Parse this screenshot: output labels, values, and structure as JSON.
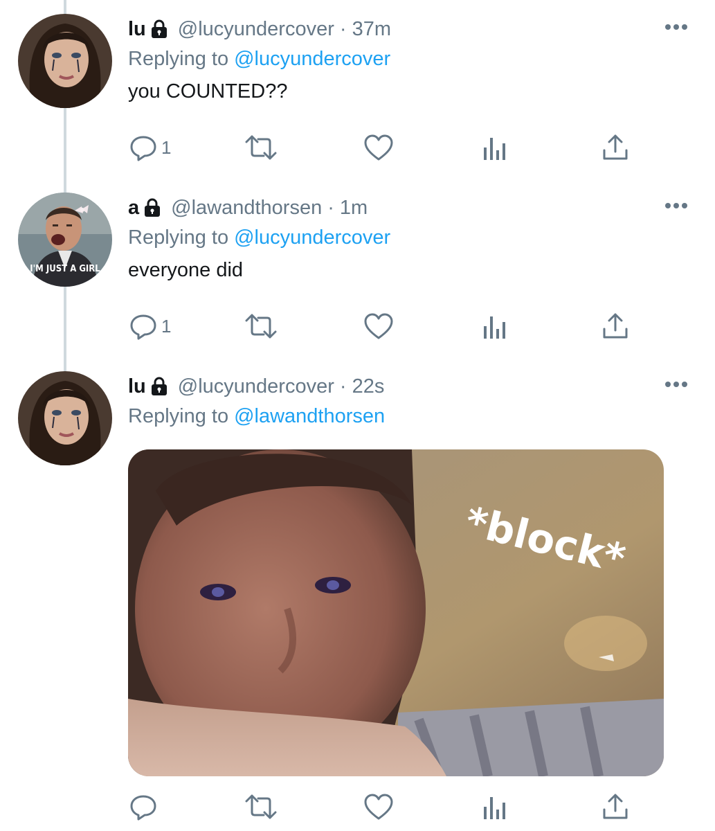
{
  "colors": {
    "text": "#14171a",
    "muted": "#657786",
    "link": "#1da1f2",
    "thread_line": "#cfd9de"
  },
  "tweets": [
    {
      "display_name": "lu",
      "handle": "@lucyundercover",
      "separator": "·",
      "time": "37m",
      "replying_prefix": "Replying to",
      "replying_to": "@lucyundercover",
      "text": "you COUNTED??",
      "reply_count": "1",
      "icons": [
        "lock-icon",
        "more-icon",
        "reply-icon",
        "retweet-icon",
        "like-icon",
        "analytics-icon",
        "share-icon"
      ]
    },
    {
      "display_name": "a",
      "handle": "@lawandthorsen",
      "separator": "·",
      "time": "1m",
      "replying_prefix": "Replying to",
      "replying_to": "@lucyundercover",
      "text": "everyone did",
      "reply_count": "1",
      "avatar_caption": "I'M JUST A GIRL"
    },
    {
      "display_name": "lu",
      "handle": "@lucyundercover",
      "separator": "·",
      "time": "22s",
      "replying_prefix": "Replying to",
      "replying_to": "@lawandthorsen",
      "media_caption": "*block*"
    }
  ]
}
